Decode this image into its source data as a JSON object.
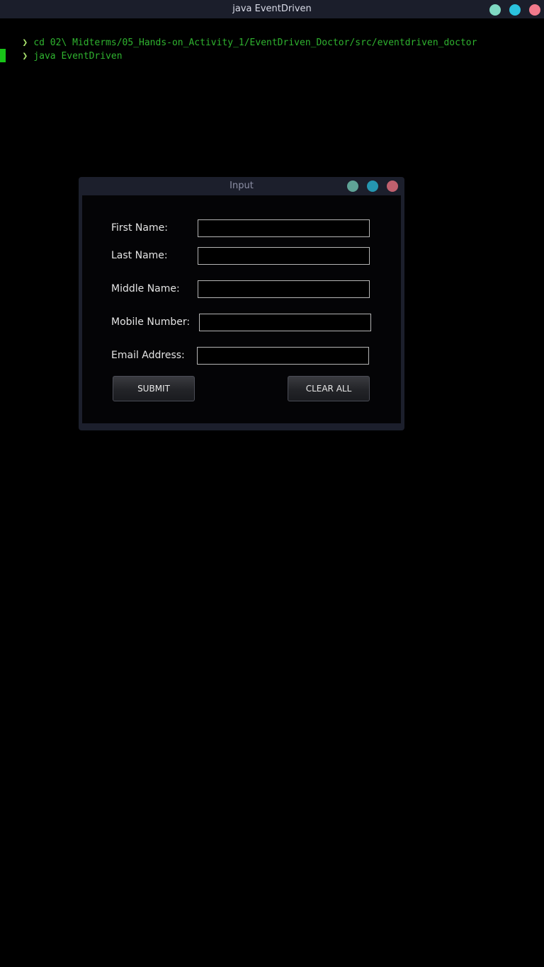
{
  "terminal": {
    "title": "java EventDriven",
    "prompt_symbol": "❯",
    "lines": [
      "cd 02\\ Midterms/05_Hands-on_Activity_1/EventDriven_Doctor/src/eventdriven_doctor",
      "java EventDriven"
    ],
    "window_buttons": {
      "minimize_color": "#7fd9c2",
      "maximize_color": "#2bc3de",
      "close_color": "#f27a8c"
    }
  },
  "dialog": {
    "title": "Input",
    "window_buttons": {
      "minimize_color": "#5fa396",
      "maximize_color": "#2596b0",
      "close_color": "#c0606e"
    },
    "fields": [
      {
        "label": "First Name:",
        "value": ""
      },
      {
        "label": "Last Name:",
        "value": ""
      },
      {
        "label": "Middle Name:",
        "value": ""
      },
      {
        "label": "Mobile Number:",
        "value": ""
      },
      {
        "label": "Email Address:",
        "value": ""
      }
    ],
    "submit_label": "SUBMIT",
    "clear_label": "CLEAR ALL"
  }
}
